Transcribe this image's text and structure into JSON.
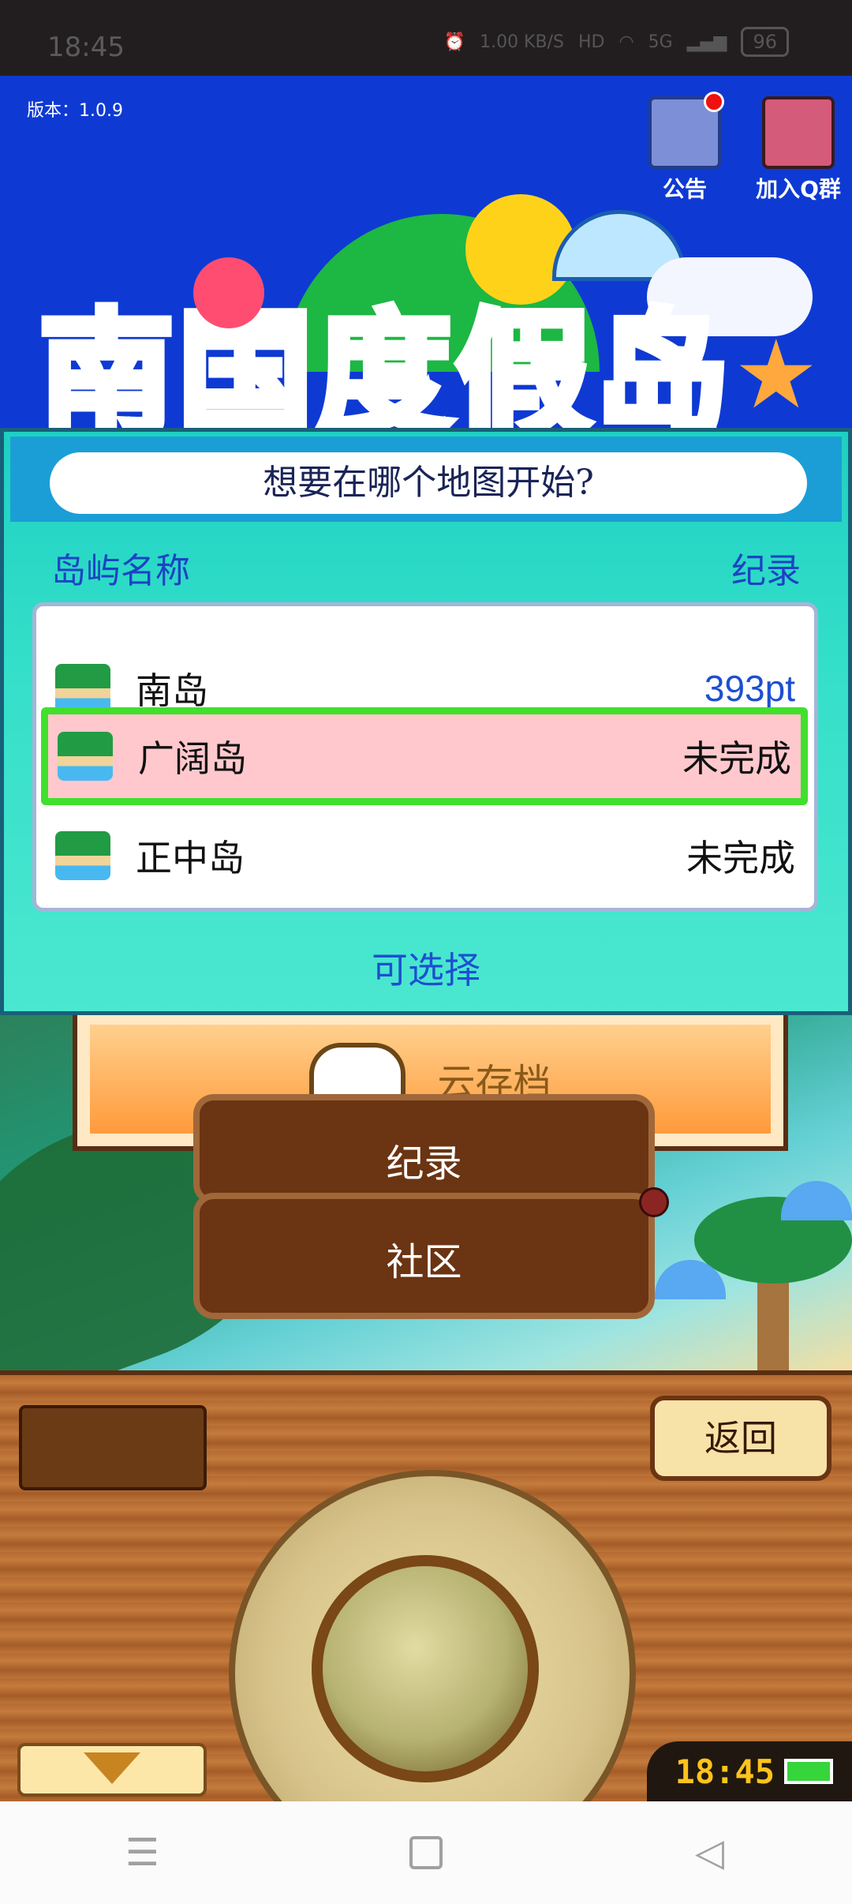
{
  "status_bar": {
    "time": "18:45",
    "net_speed": "1.00 KB/S",
    "hd": "HD",
    "signal": "5G",
    "battery": "96"
  },
  "version": "版本：1.0.9",
  "top_buttons": {
    "notice": "公告",
    "join_group": "加入Q群"
  },
  "logo": {
    "title_chars": [
      "南",
      "国",
      "度",
      "假",
      "岛"
    ]
  },
  "dialog": {
    "prompt": "想要在哪个地图开始?",
    "col_name": "岛屿名称",
    "col_record": "纪录",
    "islands": [
      {
        "name": "南岛",
        "record": "393pt",
        "selected": false
      },
      {
        "name": "广阔岛",
        "record": "未完成",
        "selected": true
      },
      {
        "name": "正中岛",
        "record": "未完成",
        "selected": false
      }
    ],
    "footer": "可选择"
  },
  "menu": {
    "cloud_save": "云存档",
    "records": "纪录",
    "community": "社区"
  },
  "control_panel": {
    "back": "返回",
    "clock": "18:45"
  }
}
